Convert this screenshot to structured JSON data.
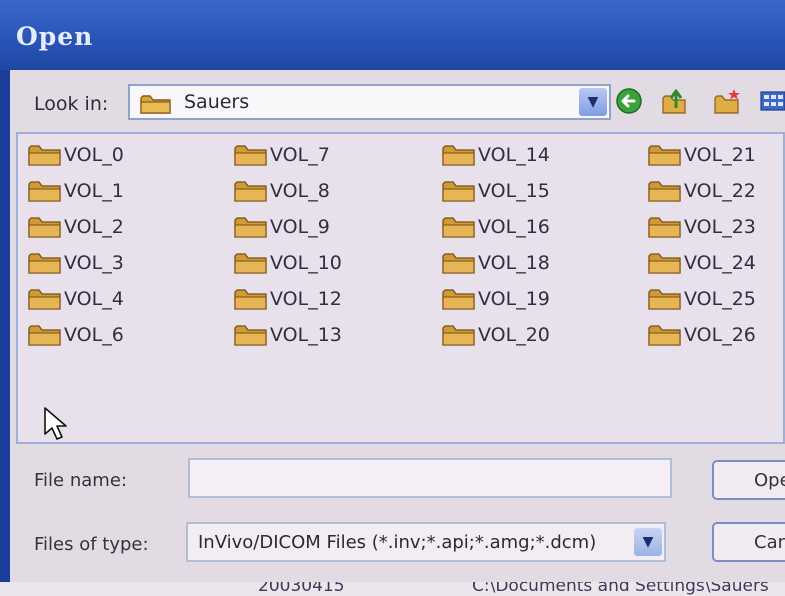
{
  "window": {
    "title": "Open"
  },
  "lookin": {
    "label": "Look in:",
    "value": "Sauers",
    "icon": "folder-icon"
  },
  "toolbar": {
    "back_icon": "back-arrow-icon",
    "up_icon": "up-folder-icon",
    "new_folder_icon": "new-folder-icon",
    "views_icon": "views-menu-icon"
  },
  "files": [
    "VOL_0",
    "VOL_1",
    "VOL_2",
    "VOL_3",
    "VOL_4",
    "VOL_6",
    "VOL_7",
    "VOL_8",
    "VOL_9",
    "VOL_10",
    "VOL_12",
    "VOL_13",
    "VOL_14",
    "VOL_15",
    "VOL_16",
    "VOL_18",
    "VOL_19",
    "VOL_20",
    "VOL_21",
    "VOL_22",
    "VOL_23",
    "VOL_24",
    "VOL_25",
    "VOL_26"
  ],
  "filename": {
    "label": "File name:",
    "value": ""
  },
  "filetype": {
    "label": "Files of type:",
    "value": "InVivo/DICOM Files (*.inv;*.api;*.amg;*.dcm)"
  },
  "buttons": {
    "open": "Open",
    "cancel": "Cancel"
  },
  "background_window": {
    "left_text": "20030415",
    "right_text": "C:\\Documents and Settings\\Sauers"
  },
  "colors": {
    "title_bar": "#2a55b8",
    "dialog_bg": "#e3dbe4",
    "folder_yellow": "#d9a640",
    "accent_blue": "#1f47a3"
  }
}
